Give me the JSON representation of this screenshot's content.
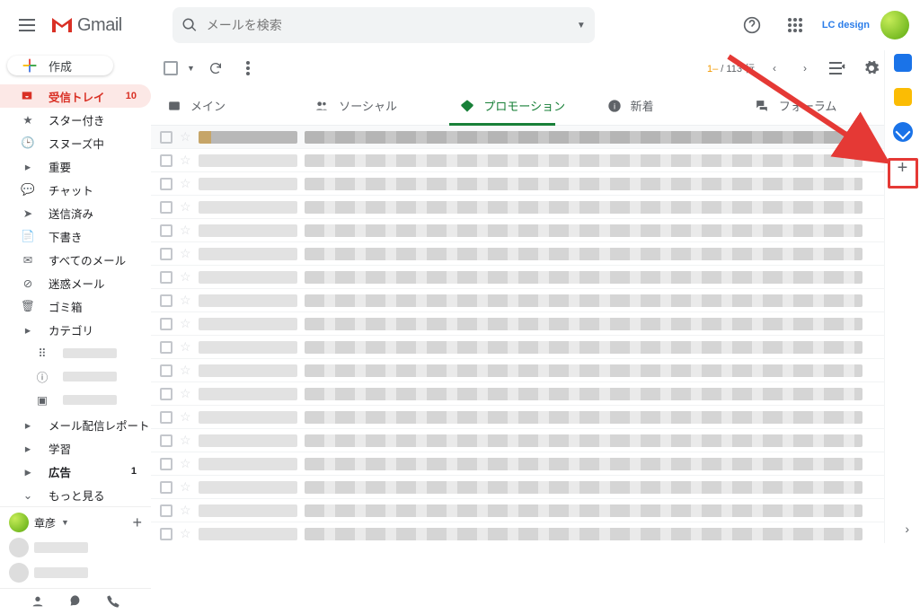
{
  "header": {
    "product": "Gmail",
    "search_placeholder": "メールを検索",
    "lc_label": "LC design"
  },
  "sidebar": {
    "compose": "作成",
    "items": [
      {
        "icon": "inbox",
        "label": "受信トレイ",
        "count": "10",
        "active": true,
        "bold": true
      },
      {
        "icon": "star",
        "label": "スター付き"
      },
      {
        "icon": "clock",
        "label": "スヌーズ中"
      },
      {
        "icon": "flag",
        "label": "重要"
      },
      {
        "icon": "chat",
        "label": "チャット"
      },
      {
        "icon": "send",
        "label": "送信済み"
      },
      {
        "icon": "file",
        "label": "下書き"
      },
      {
        "icon": "mail",
        "label": "すべてのメール"
      },
      {
        "icon": "spam",
        "label": "迷惑メール"
      },
      {
        "icon": "trash",
        "label": "ゴミ箱"
      },
      {
        "icon": "caret",
        "label": "カテゴリ"
      }
    ],
    "sub_items": [
      {
        "icon": "label",
        "label": "メール配信レポート"
      },
      {
        "icon": "label",
        "label": "学習"
      },
      {
        "icon": "label",
        "label": "広告",
        "count": "1",
        "bold": true
      },
      {
        "icon": "more",
        "label": "もっと見る"
      }
    ],
    "hangout_name": "章彦"
  },
  "toolbar": {
    "pagination_prefix": "1–",
    "pagination_suffix": " / 113 行"
  },
  "tabs": [
    {
      "icon": "primary",
      "label": "メイン"
    },
    {
      "icon": "social",
      "label": "ソーシャル"
    },
    {
      "icon": "promo",
      "label": "プロモーション",
      "active": true
    },
    {
      "icon": "updates",
      "label": "新着"
    },
    {
      "icon": "forums",
      "label": "フォーラム"
    }
  ],
  "rows": 18
}
